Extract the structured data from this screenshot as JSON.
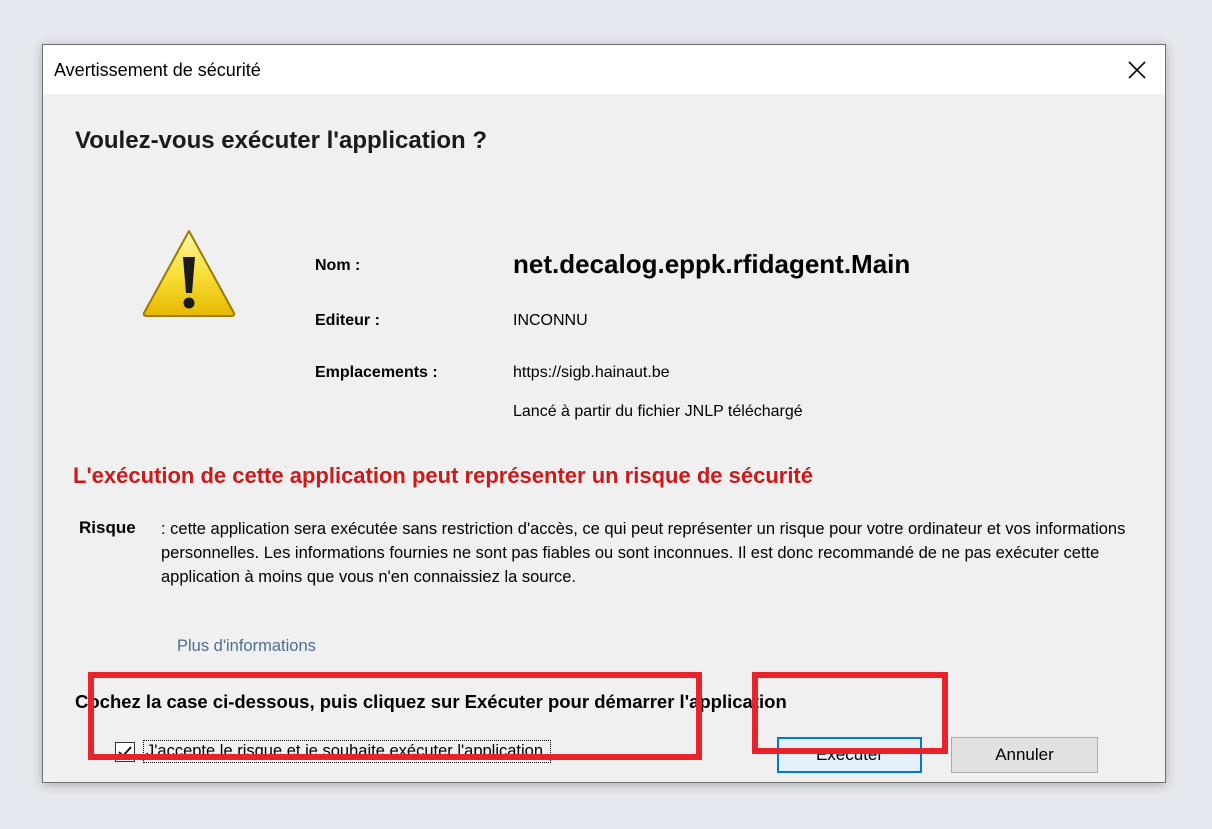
{
  "dialog": {
    "title": "Avertissement de sécurité",
    "question": "Voulez-vous exécuter l'application ?"
  },
  "fields": {
    "name_label": "Nom :",
    "name_value": "net.decalog.eppk.rfidagent.Main",
    "publisher_label": "Editeur :",
    "publisher_value": "INCONNU",
    "locations_label": "Emplacements :",
    "location_value": "https://sigb.hainaut.be",
    "location_note": "Lancé à partir du fichier JNLP téléchargé"
  },
  "risk": {
    "heading": "L'exécution de cette application peut représenter un risque de sécurité",
    "label": "Risque",
    "text": ": cette application sera exécutée sans restriction d'accès, ce qui peut représenter un risque pour votre ordinateur et vos informations personnelles. Les informations fournies ne sont pas fiables ou sont inconnues. Il est donc recommandé de ne pas exécuter cette application à moins que vous n'en connaissiez la source.",
    "more_info": "Plus d'informations"
  },
  "instruction": "Cochez la case ci-dessous, puis cliquez sur Exécuter pour démarrer l'application",
  "accept": {
    "label": "J'accepte le risque et je souhaite exécuter l'application.",
    "checked": true
  },
  "buttons": {
    "run": "Exécuter",
    "cancel": "Annuler"
  },
  "colors": {
    "risk_heading": "#cc1a1a",
    "link": "#4a6f93",
    "annotation": "#e8232b",
    "focus_border": "#0078d7"
  },
  "icons": {
    "warning": "warning-triangle-icon",
    "close": "close-icon",
    "check": "checkmark-icon"
  }
}
